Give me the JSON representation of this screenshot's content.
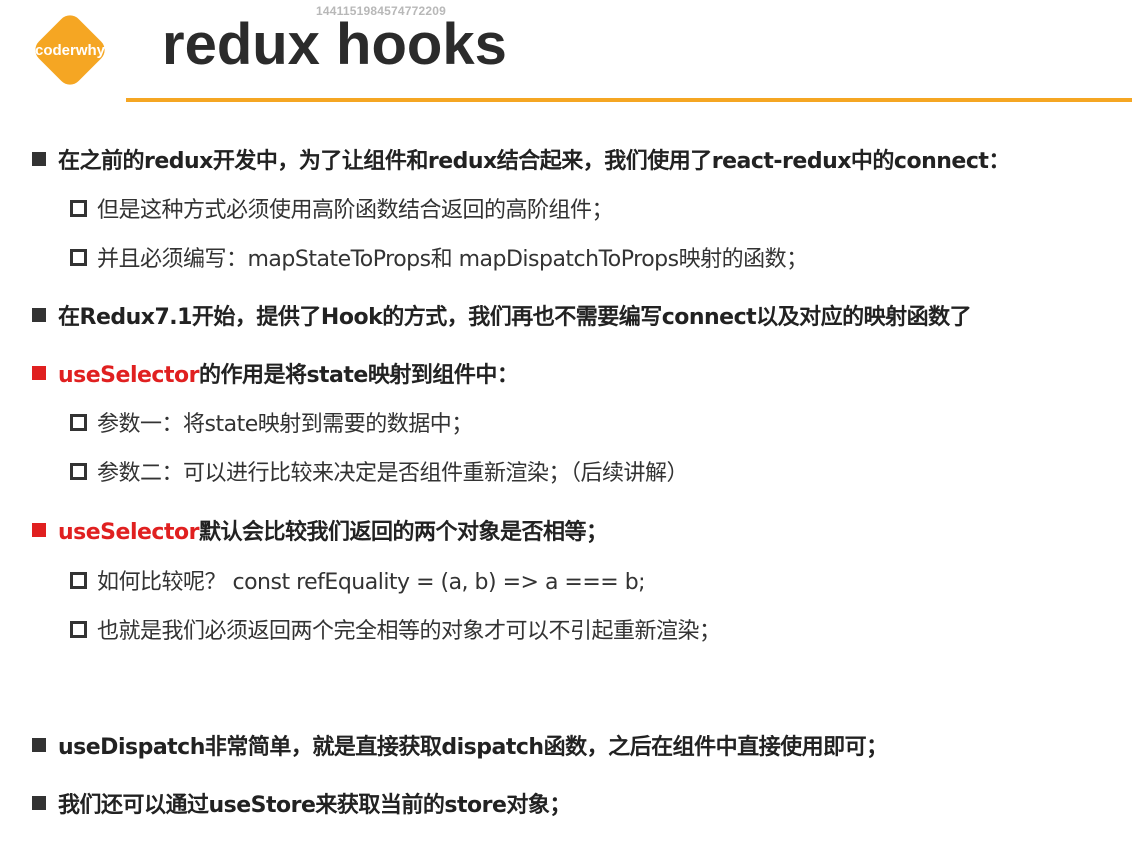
{
  "watermark": "1441151984574772209",
  "logo": {
    "text": "coderwhy",
    "color": "#f5a623"
  },
  "title": "redux hooks",
  "colors": {
    "accent": "#f5a623",
    "highlight": "#e02020",
    "text": "#222222"
  },
  "bullets": [
    {
      "text": "在之前的redux开发中，为了让组件和redux结合起来，我们使用了react-redux中的connect："
    },
    {
      "text": "但是这种方式必须使用高阶函数结合返回的高阶组件；"
    },
    {
      "text": "并且必须编写：mapStateToProps和 mapDispatchToProps映射的函数；"
    },
    {
      "text": "在Redux7.1开始，提供了Hook的方式，我们再也不需要编写connect以及对应的映射函数了"
    },
    {
      "highlight": "useSelector",
      "text": "的作用是将state映射到组件中："
    },
    {
      "text": "参数一：将state映射到需要的数据中；"
    },
    {
      "text": "参数二：可以进行比较来决定是否组件重新渲染；（后续讲解）"
    },
    {
      "highlight": "useSelector",
      "text": "默认会比较我们返回的两个对象是否相等；"
    },
    {
      "text": "如何比较呢？ const refEquality = (a, b) => a === b;"
    },
    {
      "text": "也就是我们必须返回两个完全相等的对象才可以不引起重新渲染；"
    },
    {
      "text": "useDispatch非常简单，就是直接获取dispatch函数，之后在组件中直接使用即可；"
    },
    {
      "text": "我们还可以通过useStore来获取当前的store对象；"
    }
  ]
}
